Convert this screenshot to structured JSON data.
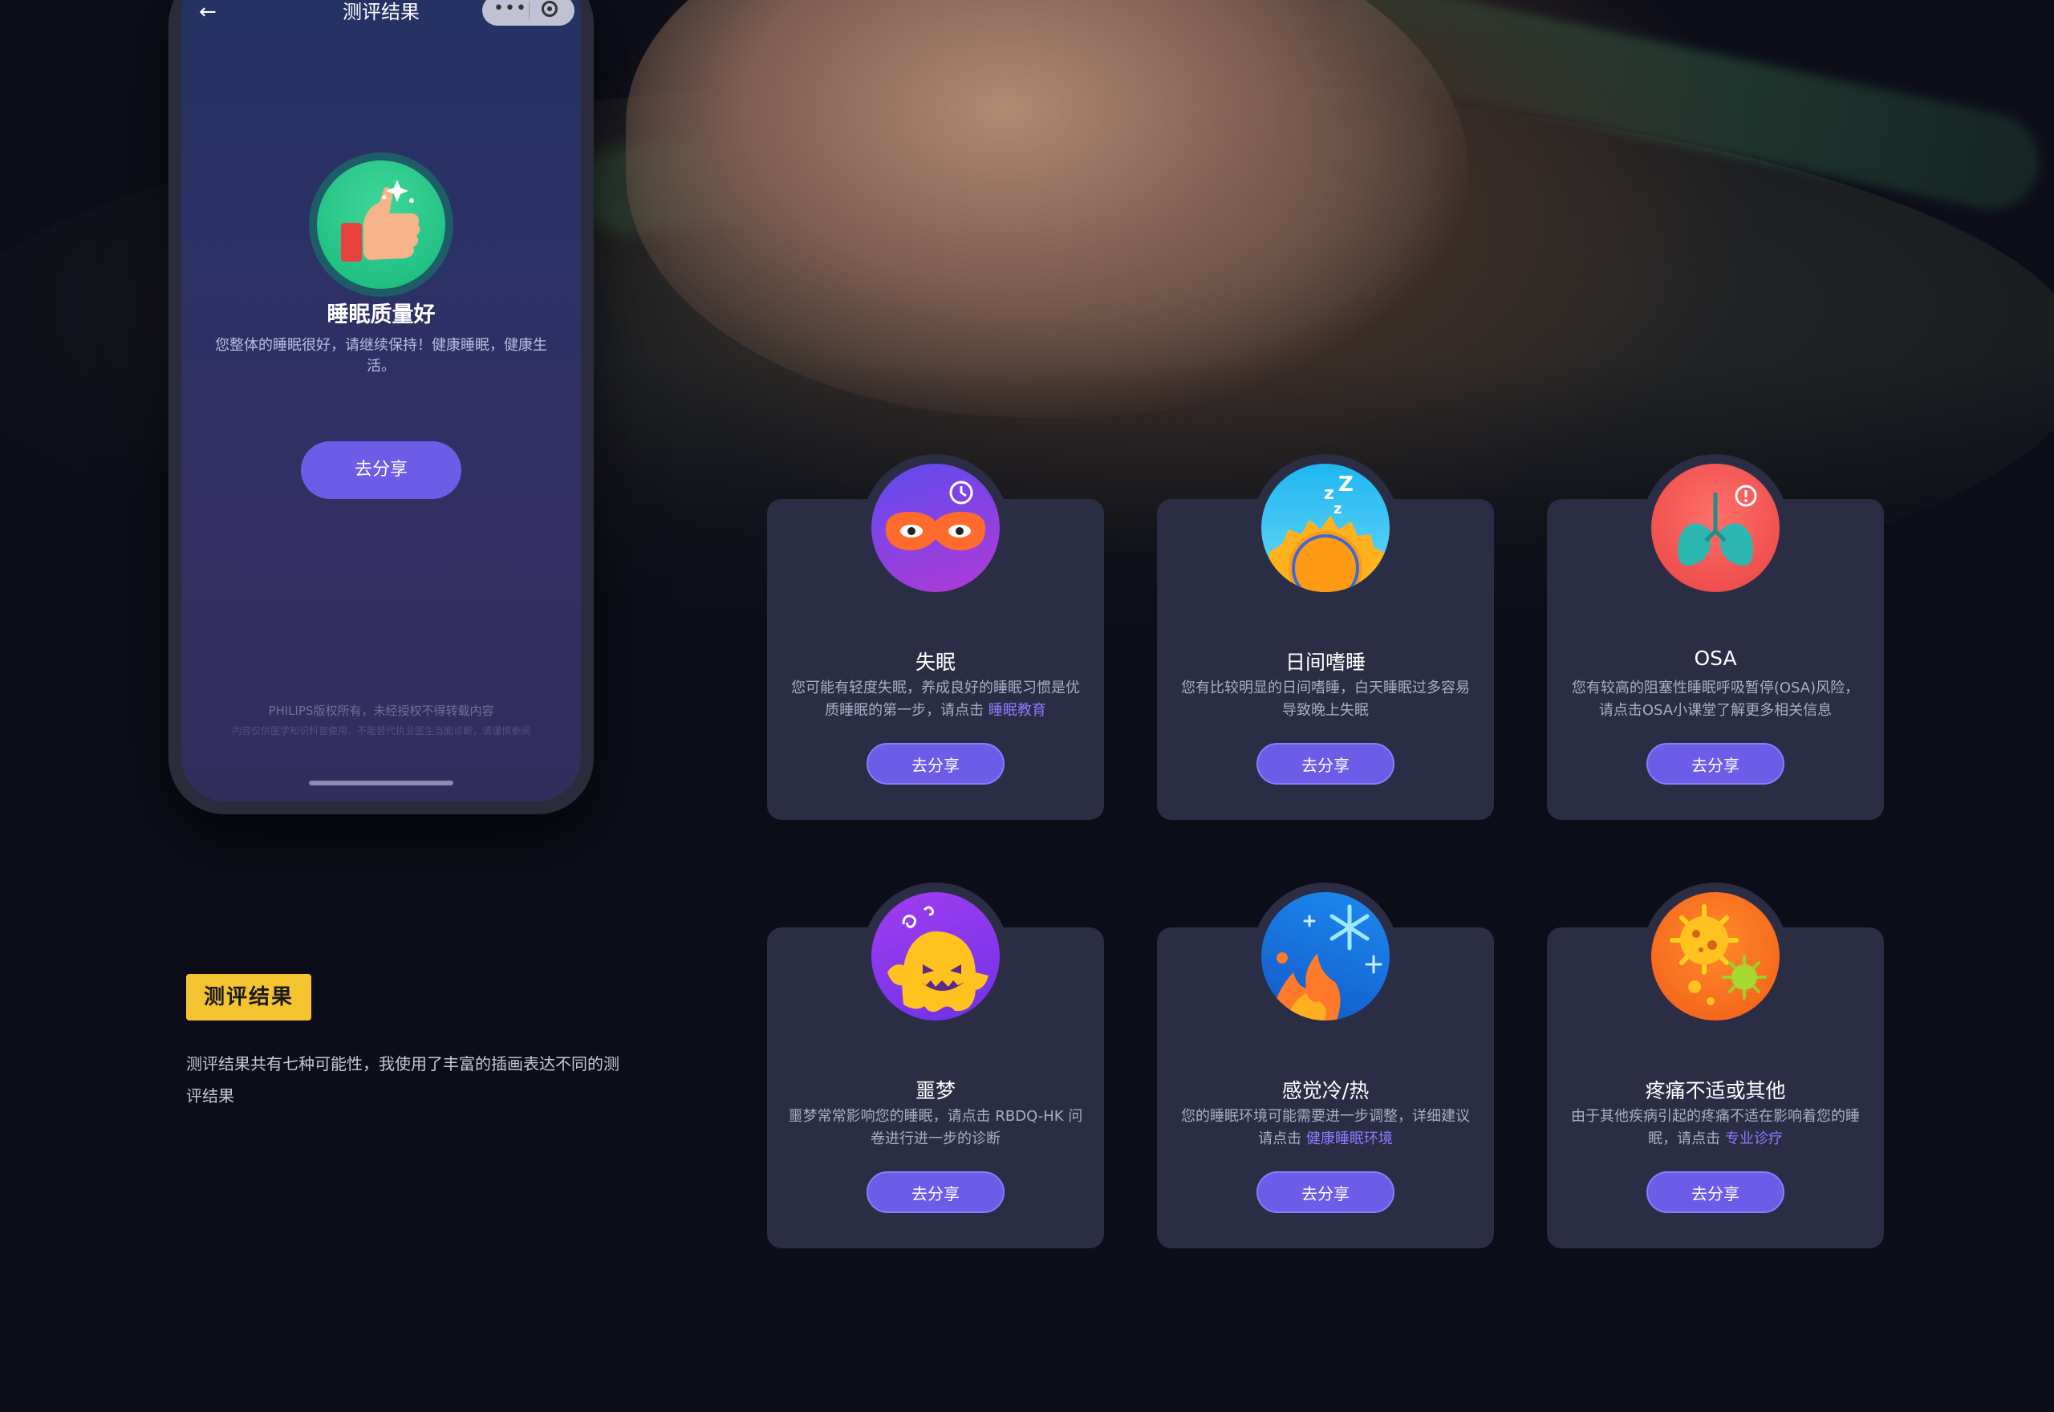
{
  "phone": {
    "title": "测评结果",
    "result_title": "睡眠质量好",
    "result_desc": "您整体的睡眠很好，请继续保持！健康睡眠，健康生活。",
    "share_label": "去分享",
    "footer_line1": "PHILIPS版权所有，未经授权不得转载内容",
    "footer_line2": "内容仅供医学知识科普使用，不能替代执业医生当面诊断，请谨慎参阅"
  },
  "caption": {
    "tag": "测评结果",
    "text": "测评结果共有七种可能性，我使用了丰富的插画表达不同的测评结果"
  },
  "cards": [
    {
      "title": "失眠",
      "desc": "您可能有轻度失眠，养成良好的睡眠习惯是优质睡眠的第一步，请点击 ",
      "link": "睡眠教育",
      "button": "去分享",
      "icon": "sleep-mask-icon"
    },
    {
      "title": "日间嗜睡",
      "desc": "您有比较明显的日间嗜睡，白天睡眠过多容易导致晚上失眠",
      "link": "",
      "button": "去分享",
      "icon": "sun-zzz-icon"
    },
    {
      "title": "OSA",
      "desc": "您有较高的阻塞性睡眠呼吸暂停(OSA)风险，请点击OSA小课堂了解更多相关信息",
      "link": "",
      "button": "去分享",
      "icon": "lungs-icon"
    },
    {
      "title": "噩梦",
      "desc": "噩梦常常影响您的睡眠，请点击 RBDQ-HK 问卷进行进一步的诊断",
      "link": "",
      "button": "去分享",
      "icon": "ghost-icon"
    },
    {
      "title": "感觉冷/热",
      "desc": "您的睡眠环境可能需要进一步调整，详细建议请点击 ",
      "link": "健康睡眠环境",
      "button": "去分享",
      "icon": "fire-snow-icon"
    },
    {
      "title": "疼痛不适或其他",
      "desc": "由于其他疾病引起的疼痛不适在影响着您的睡眠，请点击 ",
      "link": "专业诊疗",
      "button": "去分享",
      "icon": "virus-icon"
    }
  ],
  "colors": {
    "accent": "#6c5ce7",
    "card": "#2b2d45",
    "tag": "#f4c430",
    "link": "#8c7cff"
  }
}
